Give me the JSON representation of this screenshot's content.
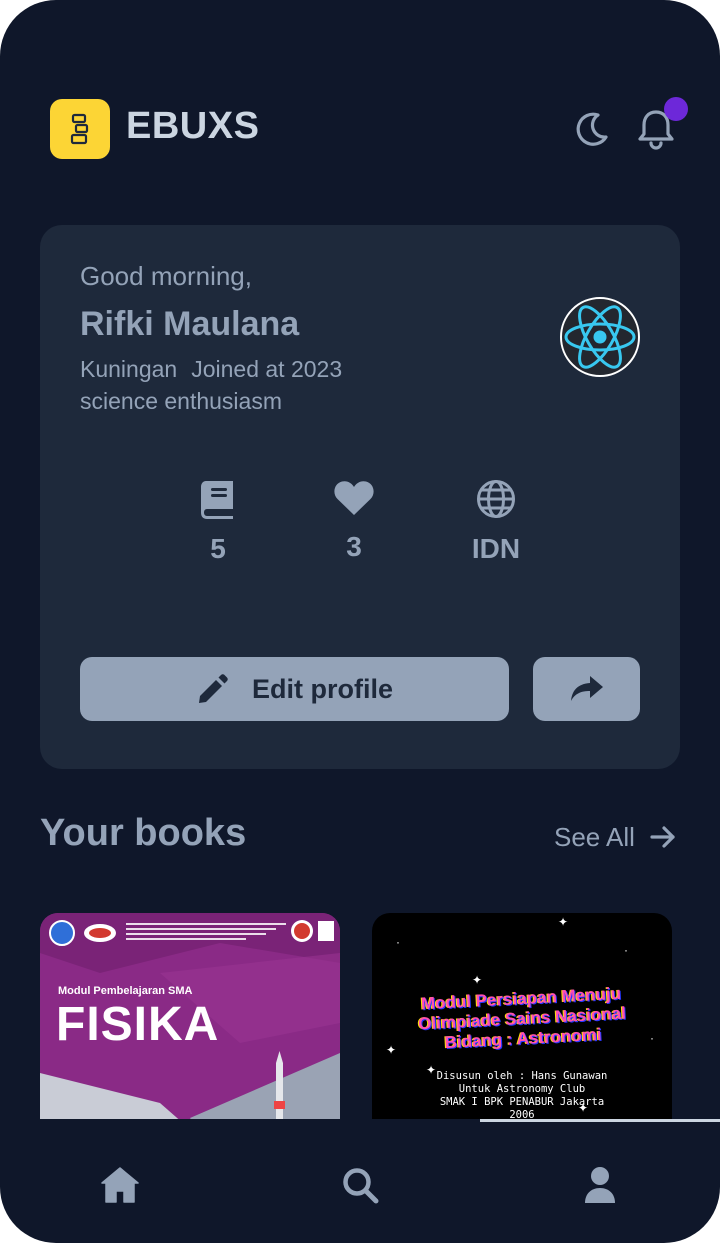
{
  "app": {
    "title": "EBUXS",
    "accent_color": "#fcd535",
    "notification_dot_color": "#6d28d9"
  },
  "header": {
    "logo_icon": "book-stack-icon",
    "theme_toggle_icon": "moon-icon",
    "notifications_icon": "bell-icon"
  },
  "profile": {
    "greeting": "Good morning,",
    "name": "Rifki Maulana",
    "location": "Kuningan",
    "joined": "Joined at 2023",
    "bio": "science enthusiasm",
    "avatar_icon": "react-logo-icon",
    "stats": [
      {
        "icon": "book-icon",
        "value": "5"
      },
      {
        "icon": "heart-icon",
        "value": "3"
      },
      {
        "icon": "globe-icon",
        "value": "IDN"
      }
    ],
    "edit_button_label": "Edit profile",
    "edit_button_icon": "pencil-icon",
    "share_button_icon": "share-icon"
  },
  "books_section": {
    "title": "Your books",
    "see_all_label": "See All",
    "see_all_icon": "arrow-right-icon",
    "books": [
      {
        "cover_subtitle": "Modul Pembelajaran SMA",
        "cover_title": "FISIKA"
      },
      {
        "cover_title_lines": [
          "Modul Persiapan Menuju",
          "Olimpiade Sains Nasional",
          "Bidang : Astronomi"
        ],
        "credits_lines": [
          "Disusun oleh : Hans Gunawan",
          "Untuk Astronomy Club",
          "SMAK I BPK PENABUR Jakarta",
          "2006"
        ]
      }
    ]
  },
  "bottom_nav": {
    "items": [
      {
        "icon": "home-icon"
      },
      {
        "icon": "search-icon"
      },
      {
        "icon": "user-icon"
      }
    ]
  }
}
